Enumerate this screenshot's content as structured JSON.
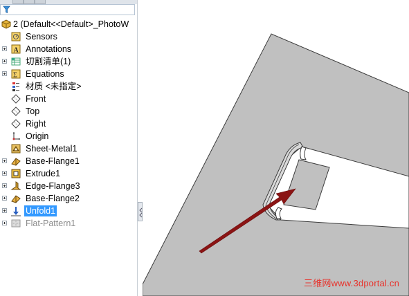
{
  "tree": {
    "root": "2  (Default<<Default>_PhotoW",
    "items": [
      {
        "label": "Sensors",
        "icon": "sensors-icon",
        "expandable": false
      },
      {
        "label": "Annotations",
        "icon": "annotations-icon",
        "expandable": true
      },
      {
        "label": "切割清单(1)",
        "icon": "cut-list-icon",
        "expandable": true
      },
      {
        "label": "Equations",
        "icon": "equations-icon",
        "expandable": true
      },
      {
        "label": "材质 <未指定>",
        "icon": "material-icon",
        "expandable": false
      },
      {
        "label": "Front",
        "icon": "plane-icon",
        "expandable": false
      },
      {
        "label": "Top",
        "icon": "plane-icon",
        "expandable": false
      },
      {
        "label": "Right",
        "icon": "plane-icon",
        "expandable": false
      },
      {
        "label": "Origin",
        "icon": "origin-icon",
        "expandable": false
      },
      {
        "label": "Sheet-Metal1",
        "icon": "sheet-metal-icon",
        "expandable": false
      },
      {
        "label": "Base-Flange1",
        "icon": "base-flange-icon",
        "expandable": true
      },
      {
        "label": "Extrude1",
        "icon": "extrude-icon",
        "expandable": true
      },
      {
        "label": "Edge-Flange3",
        "icon": "edge-flange-icon",
        "expandable": true
      },
      {
        "label": "Base-Flange2",
        "icon": "base-flange-icon",
        "expandable": true
      },
      {
        "label": "Unfold1",
        "icon": "unfold-icon",
        "expandable": true,
        "selected": true
      },
      {
        "label": "Flat-Pattern1",
        "icon": "flat-pattern-icon",
        "expandable": true,
        "suppressed": true
      }
    ]
  },
  "watermark": "三维网www.3dportal.cn",
  "colors": {
    "selection": "#3399ff",
    "sheet_face": "#c0c0c0",
    "sheet_edge": "#3b3b3b",
    "arrow": "#8b1414",
    "watermark": "#e8312a"
  }
}
